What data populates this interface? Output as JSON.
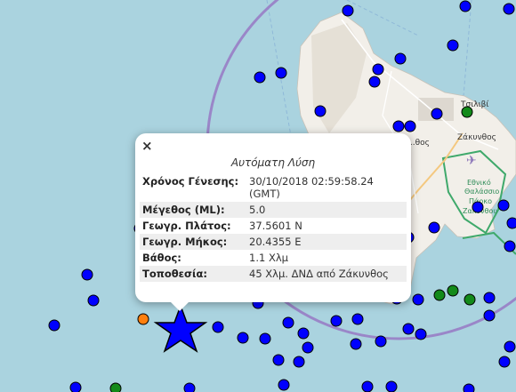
{
  "map": {
    "labels": {
      "town_north": "Τσιλιβί",
      "town_main": "Ζάκυνθος",
      "town_west": "...θος",
      "park": [
        "Εθνικό",
        "Θαλάσσιο",
        "Πάρκο",
        "Ζακύνθου"
      ]
    },
    "colors": {
      "sea": "#aad3df",
      "land": "#f2efe9",
      "event_blue": "#0000ff",
      "event_green": "#138a1a",
      "event_orange": "#ff7f0e",
      "ring": "#9a86c8",
      "park": "#3fa96b"
    }
  },
  "popup": {
    "close_label": "×",
    "title": "Αυτόματη Λύση",
    "rows": [
      {
        "key": "Χρόνος Γένεσης:",
        "value": "30/10/2018 02:59:58.24 (GMT)"
      },
      {
        "key": "Μέγεθος (ML):",
        "value": "5.0"
      },
      {
        "key": "Γεωγρ. Πλάτος:",
        "value": "37.5601 N"
      },
      {
        "key": "Γεωγρ. Μήκος:",
        "value": "20.4355 E"
      },
      {
        "key": "Βάθος:",
        "value": "1.1 Χλμ"
      },
      {
        "key": "Τοποθεσία:",
        "value": "45 Χλμ. ΔΝΔ από Ζάκυνθος"
      }
    ]
  }
}
